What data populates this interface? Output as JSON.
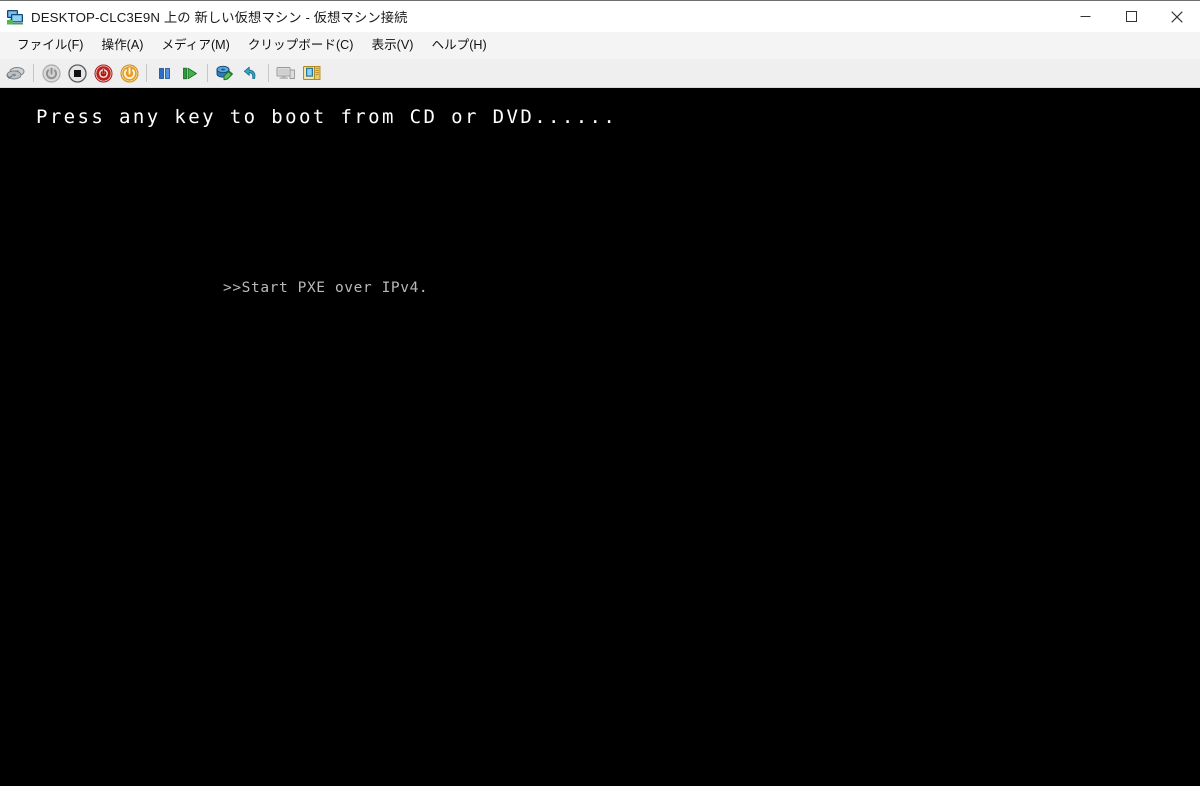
{
  "window": {
    "title": "DESKTOP-CLC3E9N 上の 新しい仮想マシン  - 仮想マシン接続",
    "icon": "virtual-machine-connection-icon",
    "controls": {
      "minimize": "最小化",
      "maximize": "最大化",
      "close": "閉じる"
    }
  },
  "menubar": {
    "items": [
      {
        "label": "ファイル(F)",
        "name": "menu-file"
      },
      {
        "label": "操作(A)",
        "name": "menu-action"
      },
      {
        "label": "メディア(M)",
        "name": "menu-media"
      },
      {
        "label": "クリップボード(C)",
        "name": "menu-clipboard"
      },
      {
        "label": "表示(V)",
        "name": "menu-view"
      },
      {
        "label": "ヘルプ(H)",
        "name": "menu-help"
      }
    ]
  },
  "toolbar": {
    "buttons": [
      {
        "name": "ctrl-alt-delete-icon",
        "tooltip": "Ctrl+Alt+Delete",
        "enabled": true
      },
      {
        "name": "start-icon",
        "tooltip": "起動",
        "enabled": false
      },
      {
        "name": "turn-off-icon",
        "tooltip": "シャットダウン",
        "enabled": true
      },
      {
        "name": "shut-down-icon",
        "tooltip": "電源を切る",
        "enabled": true
      },
      {
        "name": "reset-icon",
        "tooltip": "リセット",
        "enabled": true
      },
      {
        "name": "pause-icon",
        "tooltip": "一時停止",
        "enabled": true
      },
      {
        "name": "resume-icon",
        "tooltip": "再開",
        "enabled": true
      },
      {
        "name": "checkpoint-icon",
        "tooltip": "チェックポイント",
        "enabled": true
      },
      {
        "name": "revert-icon",
        "tooltip": "元に戻す",
        "enabled": true
      },
      {
        "name": "basic-session-icon",
        "tooltip": "基本セッション",
        "enabled": false
      },
      {
        "name": "enhanced-session-icon",
        "tooltip": "拡張セッション",
        "enabled": true
      }
    ]
  },
  "console": {
    "background_color": "#000000",
    "boot_prompt": "Press any key to boot from CD or DVD......",
    "pxe_message": ">>Start PXE over IPv4.",
    "boot_prompt_color": "#ffffff",
    "pxe_message_color": "#b9b9b9"
  }
}
